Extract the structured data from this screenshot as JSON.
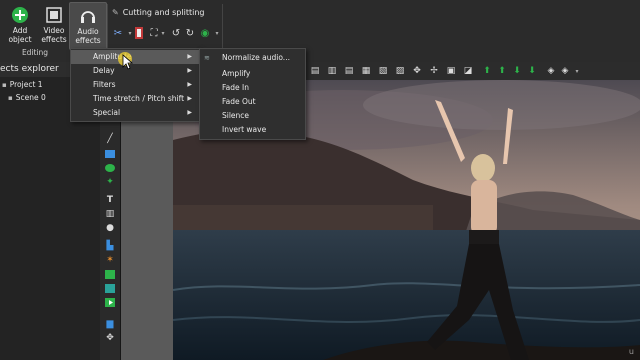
{
  "ribbon": {
    "add_object": "Add object",
    "video_effects": "Video effects",
    "audio_effects": "Audio effects",
    "group_label": "Editing",
    "cutting_title": "Cutting and splitting"
  },
  "explorer": {
    "header": "ects explorer",
    "project": "Project 1",
    "scene": "Scene 0"
  },
  "audio_menu": {
    "items": [
      {
        "label": "Amplitude",
        "has_submenu": true,
        "highlighted": true
      },
      {
        "label": "Delay",
        "has_submenu": true
      },
      {
        "label": "Filters",
        "has_submenu": true
      },
      {
        "label": "Time stretch / Pitch shift",
        "has_submenu": true
      },
      {
        "label": "Special",
        "has_submenu": true
      }
    ]
  },
  "amplitude_submenu": {
    "items": [
      {
        "label": "Normalize audio..."
      },
      {
        "label": "Amplify"
      },
      {
        "label": "Fade In"
      },
      {
        "label": "Fade Out"
      },
      {
        "label": "Silence"
      },
      {
        "label": "Invert wave"
      }
    ]
  },
  "watermark": "u",
  "colors": {
    "accent_green": "#2db34a",
    "ribbon_bg": "#2b2b2b",
    "menu_bg": "#2f2f2f",
    "highlight": "#5a5a5a"
  }
}
